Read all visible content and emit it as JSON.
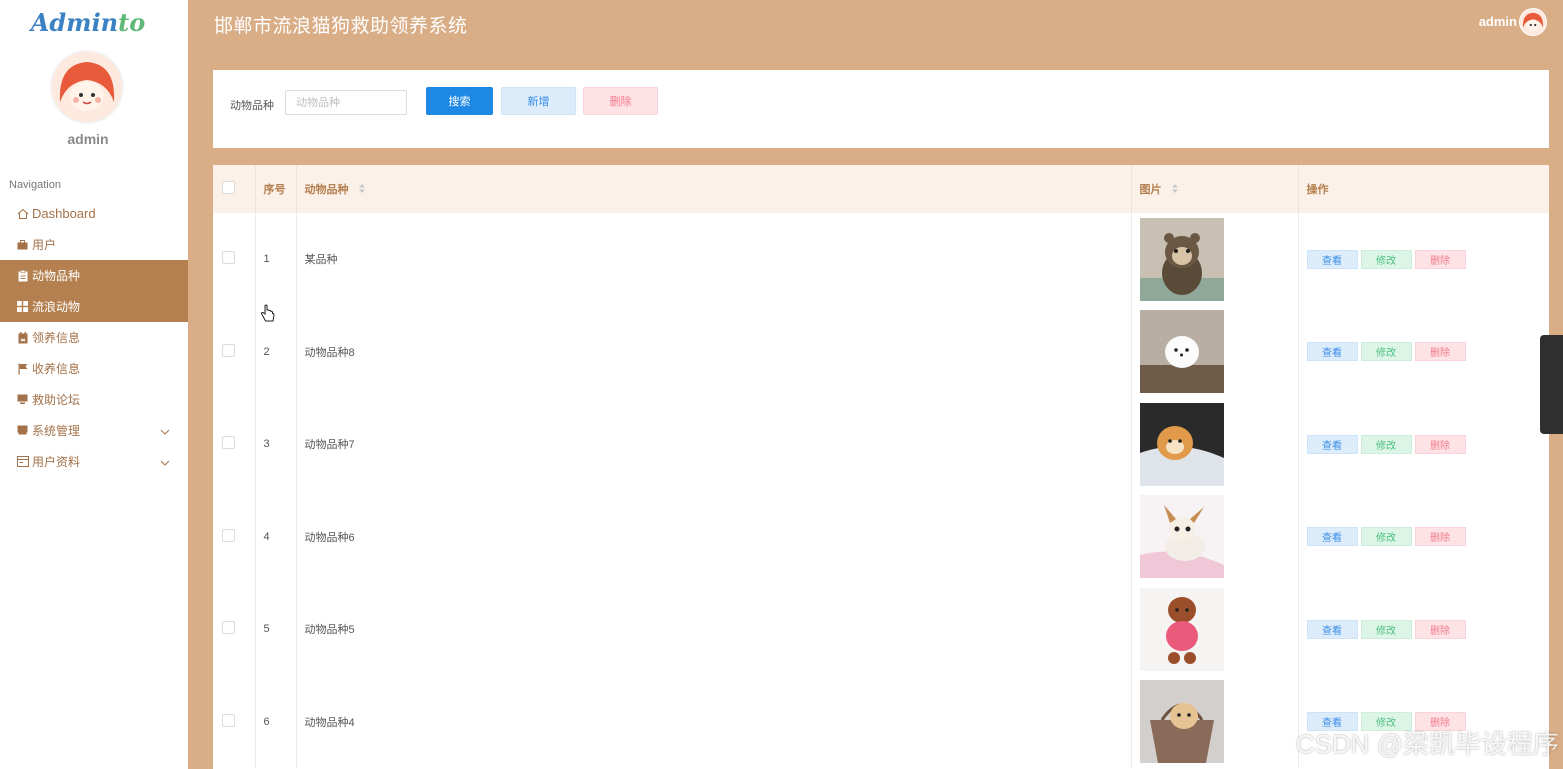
{
  "sidebar": {
    "logo_part1": "Admin",
    "logo_part2": "to",
    "username": "admin",
    "nav_heading": "Navigation",
    "items": [
      {
        "label": "Dashboard",
        "icon": "home-icon"
      },
      {
        "label": "用户",
        "icon": "briefcase-icon"
      },
      {
        "label": "动物品种",
        "icon": "clipboard-icon"
      },
      {
        "label": "流浪动物",
        "icon": "grid-icon"
      },
      {
        "label": "领养信息",
        "icon": "calendar-icon"
      },
      {
        "label": "收养信息",
        "icon": "flag-icon"
      },
      {
        "label": "救助论坛",
        "icon": "monitor-icon"
      },
      {
        "label": "系统管理",
        "icon": "drawer-icon"
      },
      {
        "label": "用户资料",
        "icon": "form-icon"
      }
    ]
  },
  "header": {
    "title": "邯郸市流浪猫狗救助领养系统",
    "username": "admin"
  },
  "search": {
    "label": "动物品种",
    "placeholder": "动物品种",
    "value": "",
    "search_button": "搜索",
    "add_button": "新增",
    "delete_button": "删除"
  },
  "table": {
    "columns": [
      "序号",
      "动物品种",
      "图片",
      "操作"
    ],
    "rows": [
      {
        "index": "1",
        "breed": "某品种"
      },
      {
        "index": "2",
        "breed": "动物品种8"
      },
      {
        "index": "3",
        "breed": "动物品种7"
      },
      {
        "index": "4",
        "breed": "动物品种6"
      },
      {
        "index": "5",
        "breed": "动物品种5"
      },
      {
        "index": "6",
        "breed": "动物品种4"
      }
    ],
    "actions": {
      "view": "查看",
      "edit": "修改",
      "delete": "删除"
    }
  },
  "watermark": "CSDN @梁凯毕设程序",
  "colors": {
    "header_bg": "#d9ad86",
    "sidebar_active": "#b5804f",
    "primary": "#1e88e5"
  }
}
